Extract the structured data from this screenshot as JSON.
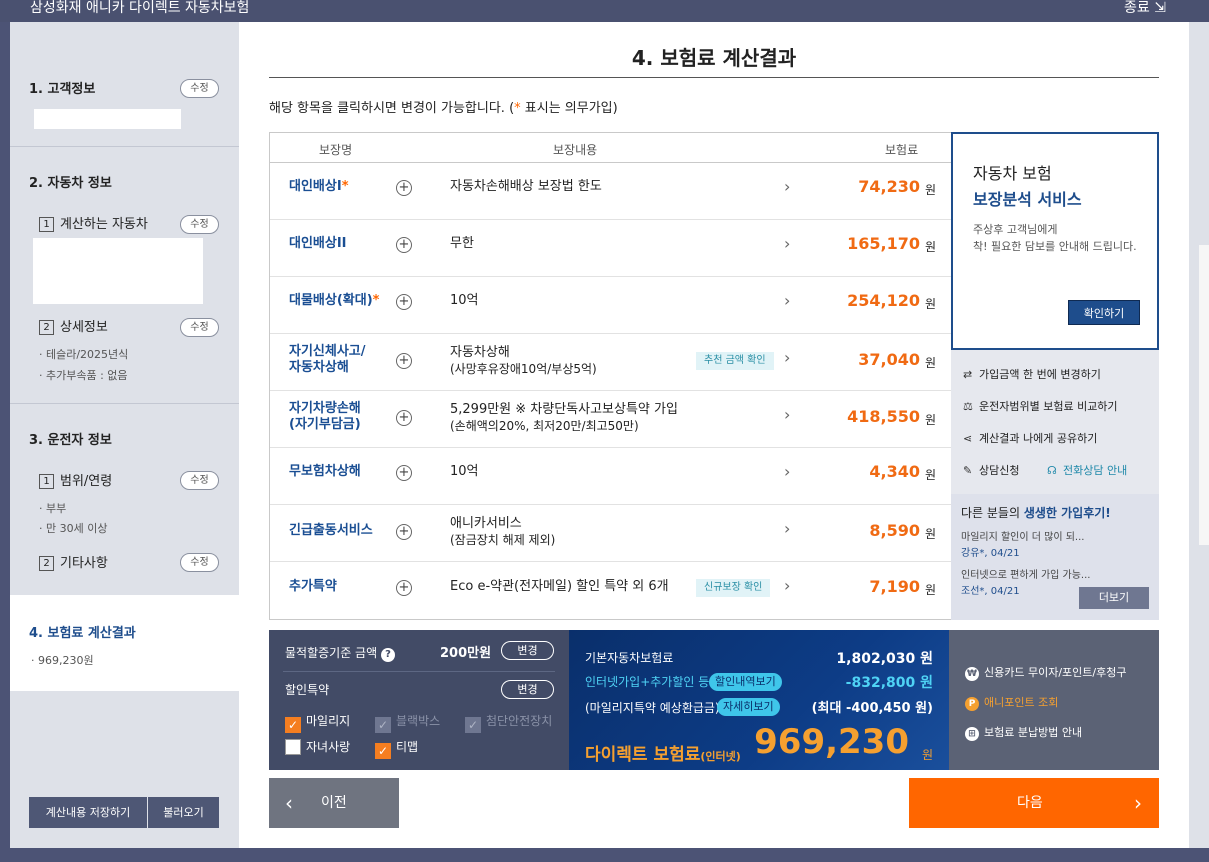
{
  "window": {
    "title": "삼성화재 애니카 다이렉트 자동차보험",
    "close_label": "종료 ⇲"
  },
  "sidebar": {
    "edit_label": "수정",
    "step1": {
      "title": "1. 고객정보"
    },
    "step2": {
      "title": "2. 자동차 정보",
      "sub1_num": "1",
      "sub1": "계산하는 자동차",
      "sub2_num": "2",
      "sub2": "상세정보",
      "bullets": [
        "· 테슬라/2025년식",
        "· 추가부속품 : 없음"
      ]
    },
    "step3": {
      "title": "3. 운전자 정보",
      "sub1_num": "1",
      "sub1": "범위/연령",
      "bullets": [
        "· 부부",
        "· 만 30세 이상"
      ],
      "sub2_num": "2",
      "sub2": "기타사항"
    },
    "step4": {
      "title": "4. 보험료 계산결과",
      "bullet": "· 969,230원"
    },
    "save_button": "계산내용 저장하기",
    "load_button": "불러오기"
  },
  "main": {
    "page_title": "4. 보험료 계산결과",
    "guide_prefix": "해당 항목을 클릭하시면 변경이 가능합니다. (",
    "guide_star": "*",
    "guide_suffix": " 표시는 의무가입)",
    "headers": {
      "name": "보장명",
      "content": "보장내용",
      "premium": "보험료"
    },
    "won": "원",
    "star": "*",
    "rows": [
      {
        "name": "대인배상I",
        "content": "자동차손해배상 보장법 한도",
        "amount": "74,230"
      },
      {
        "name": "대인배상II",
        "content": "무한",
        "amount": "165,170"
      },
      {
        "name": "대물배상(확대)",
        "content": "10억",
        "amount": "254,120"
      },
      {
        "name1": "자기신체사고/",
        "name2": "자동차상해",
        "content1": "자동차상해",
        "content2": "(사망후유장애10억/부상5억)",
        "tag": "추천 금액 확인",
        "amount": "37,040"
      },
      {
        "name1": "자기차량손해",
        "name2": "(자기부담금)",
        "content1": "5,299만원 ※ 차량단독사고보상특약 가입",
        "content2": "(손해액의20%, 최저20만/최고50만)",
        "amount": "418,550"
      },
      {
        "name": "무보험차상해",
        "content": "10억",
        "amount": "4,340"
      },
      {
        "name": "긴급출동서비스",
        "content1": "애니카서비스",
        "content2": "(잠금장치 해제 제외)",
        "amount": "8,590"
      },
      {
        "name": "추가특약",
        "content": "Eco e-약관(전자메일) 할인 특약 외 6개",
        "tag": "신규보장 확인",
        "amount": "7,190"
      }
    ]
  },
  "promo": {
    "line1": "자동차 보험",
    "line2": "보장분석 서비스",
    "line3": "주상후 고객님에게",
    "line4": "착! 필요한 담보를 안내해 드립니다.",
    "button": "확인하기"
  },
  "quick_links": {
    "change_all": "가입금액 한 번에 변경하기",
    "compare": "운전자범위별 보험료 비교하기",
    "share": "계산결과 나에게 공유하기",
    "consult": "상담신청",
    "phone": "전화상담 안내"
  },
  "review": {
    "heading_prefix": "다른 분들의 ",
    "heading_highlight": "생생한 가입후기!",
    "items": [
      {
        "text": "마일리지 할인이 더 많이 되...",
        "author": "강유*, 04/21"
      },
      {
        "text": "인터넷으로 편하게 가입 가능...",
        "author": "조선*, 04/21"
      }
    ],
    "more_button": "더보기"
  },
  "discount_panel": {
    "property_label": "물적할증기준 금액",
    "property_value": "200만원",
    "change_label": "변경",
    "discount_label": "할인특약",
    "options": [
      {
        "label": "마일리지",
        "state": "checked"
      },
      {
        "label": "블랙박스",
        "state": "disabled"
      },
      {
        "label": "첨단안전장치",
        "state": "disabled"
      },
      {
        "label": "자녀사랑",
        "state": "unchecked"
      },
      {
        "label": "티맵",
        "state": "checked"
      }
    ]
  },
  "premium_panel": {
    "base_label": "기본자동차보험료",
    "base_value": "1,802,030 원",
    "discount_label": "인터넷가입+추가할인 등",
    "discount_badge": "할인내역보기",
    "discount_value": "-832,800 원",
    "refund_label": "(마일리지특약 예상환급금)",
    "refund_badge": "자세히보기",
    "refund_value": "(최대 -400,450 원)",
    "total_label": "다이렉트 보험료",
    "total_sub": "(인터넷)",
    "total_value": "969,230",
    "won": "원"
  },
  "payment_panel": {
    "card": "신용카드 무이자/포인트/후청구",
    "point": "애니포인트 조회",
    "installment": "보험료 분납방법 안내"
  },
  "nav": {
    "prev": "이전",
    "next": "다음"
  },
  "colors": {
    "accent": "#ff6600",
    "navy": "#1e4d8c",
    "sidebar": "#dee1e8"
  }
}
